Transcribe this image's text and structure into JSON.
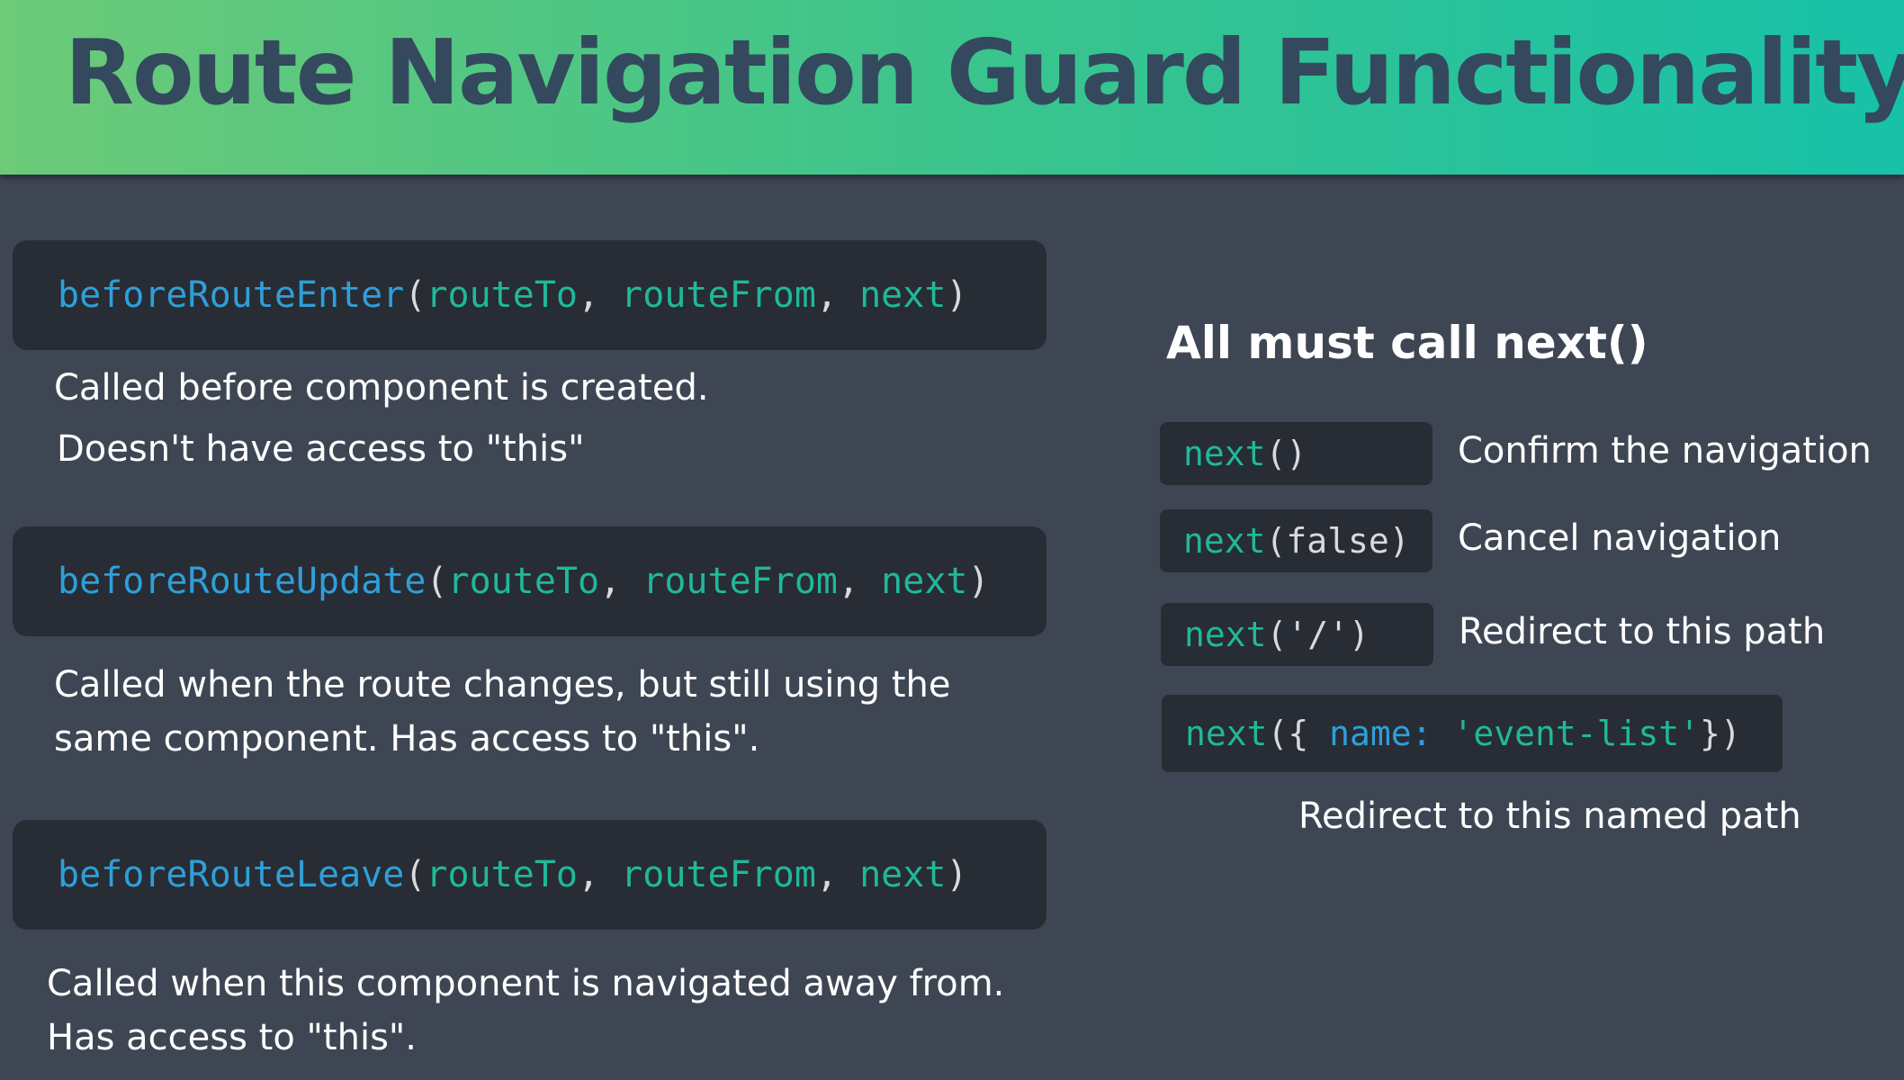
{
  "header": {
    "title": "Route Navigation Guard Functionality"
  },
  "guards": [
    {
      "fn": "beforeRouteEnter",
      "args": [
        "routeTo",
        "routeFrom",
        "next"
      ],
      "desc_lines": [
        "Called before component is created.",
        "Doesn't have access to \"this\""
      ]
    },
    {
      "fn": "beforeRouteUpdate",
      "args": [
        "routeTo",
        "routeFrom",
        "next"
      ],
      "desc_lines": [
        "Called when the route changes, but still using the",
        "same component.  Has access to \"this\"."
      ]
    },
    {
      "fn": "beforeRouteLeave",
      "args": [
        "routeTo",
        "routeFrom",
        "next"
      ],
      "desc_lines": [
        "Called when this component is navigated away from.",
        "Has access to \"this\"."
      ]
    }
  ],
  "right": {
    "title": "All must call next()",
    "options": [
      {
        "code_fn": "next",
        "code_rest": "()",
        "label": "Confirm the navigation"
      },
      {
        "code_fn": "next",
        "code_rest": "(false)",
        "label": "Cancel navigation"
      },
      {
        "code_fn": "next",
        "code_rest": "('/')",
        "label": "Redirect to this path"
      }
    ],
    "named": {
      "code_fn": "next",
      "open": "({ ",
      "key": "name:",
      "value": "'event-list'",
      "close": "})",
      "label": "Redirect to this named path"
    }
  },
  "colors": {
    "background": "#3f4653",
    "header_gradient_start": "#6cca78",
    "header_gradient_end": "#17c1a8",
    "title_text": "#34495e",
    "code_bg": "#282c34",
    "code_function": "#2e9fd9",
    "code_argument": "#1fb89a"
  }
}
